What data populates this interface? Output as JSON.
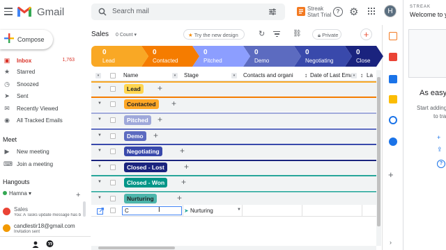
{
  "header": {
    "app_name": "Gmail",
    "search_placeholder": "Search mail",
    "streak_title": "Streak",
    "streak_subtitle": "Start Trial",
    "avatar_letter": "H"
  },
  "compose_label": "Compose",
  "nav": [
    {
      "label": "Inbox",
      "count": "1,763",
      "icon": "inbox-icon",
      "active": true
    },
    {
      "label": "Starred",
      "icon": "star-icon"
    },
    {
      "label": "Snoozed",
      "icon": "clock-icon"
    },
    {
      "label": "Sent",
      "icon": "send-icon"
    },
    {
      "label": "Recently Viewed",
      "icon": "envelope-icon"
    },
    {
      "label": "All Tracked Emails",
      "icon": "eye-icon"
    }
  ],
  "meet": {
    "title": "Meet",
    "items": [
      {
        "label": "New meeting",
        "icon": "video-icon"
      },
      {
        "label": "Join a meeting",
        "icon": "keyboard-icon"
      }
    ]
  },
  "hangouts": {
    "title": "Hangouts",
    "user": "Hamna",
    "contacts": [
      {
        "name": "Sales",
        "sub": "You: A Tasks update message has b"
      },
      {
        "name": "candlestir18@gmail.com",
        "sub": "Invitation sent"
      }
    ]
  },
  "pipeline": {
    "name": "Sales",
    "count_label": "0 Count",
    "try_label": "Try the new design",
    "private_label": "Private"
  },
  "stages": [
    {
      "count": "0",
      "name": "Lead",
      "color": "#f9a825"
    },
    {
      "count": "0",
      "name": "Contacted",
      "color": "#f57c00"
    },
    {
      "count": "0",
      "name": "Pitched",
      "color": "#8c9eff"
    },
    {
      "count": "0",
      "name": "Demo",
      "color": "#5c6bc0"
    },
    {
      "count": "0",
      "name": "Negotiating",
      "color": "#3949ab"
    },
    {
      "count": "0",
      "name": "Close",
      "color": "#1a237e"
    }
  ],
  "columns": {
    "name": "Name",
    "stage": "Stage",
    "contacts": "Contacts and organi",
    "date": "Date of Last Emai",
    "last": "La"
  },
  "groups": [
    {
      "name": "Lead",
      "bg": "#ffd54f",
      "fg": "#202124",
      "bar": "#f9a825"
    },
    {
      "name": "Contacted",
      "bg": "#ffa726",
      "fg": "#202124",
      "bar": "#f57c00"
    },
    {
      "name": "Pitched",
      "bg": "#9fa8da",
      "fg": "#ffffff",
      "bar": "#9fa8da"
    },
    {
      "name": "Demo",
      "bg": "#5c6bc0",
      "fg": "#ffffff",
      "bar": "#5c6bc0"
    },
    {
      "name": "Negotiating",
      "bg": "#3949ab",
      "fg": "#ffffff",
      "bar": "#3949ab"
    },
    {
      "name": "Closed - Lost",
      "bg": "#1a237e",
      "fg": "#ffffff",
      "bar": "#1a237e"
    },
    {
      "name": "Closed - Won",
      "bg": "#009688",
      "fg": "#ffffff",
      "bar": "#26a69a"
    },
    {
      "name": "Nurturing",
      "bg": "#4db6ac",
      "fg": "#202124",
      "bar": "#4db6ac"
    }
  ],
  "new_row": {
    "name_value": "C",
    "stage": "Nurturing"
  },
  "sidepanel": {
    "brand": "STREAK",
    "title": "Welcome to yo",
    "heading": "As easy",
    "text1": "Start adding",
    "text2": "to tra"
  }
}
